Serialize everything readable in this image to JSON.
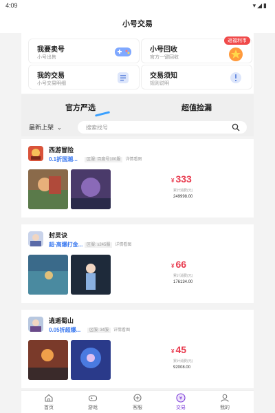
{
  "statusbar": {
    "time": "4:09",
    "icons": "▾◢▮"
  },
  "header": {
    "title": "小号交易"
  },
  "hero_cards": [
    {
      "title": "我要卖号",
      "subtitle": "小号出售",
      "icon": "gamepad-icon"
    },
    {
      "title": "小号回收",
      "subtitle": "官方一键回收",
      "icon": "medal-icon",
      "badge": "返福利币"
    },
    {
      "title": "我的交易",
      "subtitle": "小号交易明细",
      "icon": "document-icon"
    },
    {
      "title": "交易须知",
      "subtitle": "规则说明",
      "icon": "info-icon"
    }
  ],
  "tabs": [
    {
      "label": "官方严选",
      "active": true
    },
    {
      "label": "超值捡漏",
      "active": false
    }
  ],
  "filter": {
    "sort_label": "最新上架",
    "search_placeholder": "搜索找号"
  },
  "listings": [
    {
      "name": "西游冒险",
      "tagline": "0.1折国潮...",
      "server": "区服: 百度号100服",
      "detail": "详情看图",
      "price": "333",
      "currency": "¥",
      "paid_label": "累计消费(元)",
      "paid_value": "249998.00"
    },
    {
      "name": "封灵诀",
      "tagline": "超·高爆打金...",
      "server": "区服: s245服",
      "detail": "详情看图",
      "price": "66",
      "currency": "¥",
      "paid_label": "累计消费(元)",
      "paid_value": "176134.00"
    },
    {
      "name": "逍遥蜀山",
      "tagline": "0.05折超爆...",
      "server": "区服: 34服",
      "detail": "详情看图",
      "price": "45",
      "currency": "¥",
      "paid_label": "累计消费(元)",
      "paid_value": "92008.00"
    }
  ],
  "nav": [
    {
      "label": "首页",
      "icon": "home-icon",
      "active": false
    },
    {
      "label": "游戏",
      "icon": "controller-icon",
      "active": false
    },
    {
      "label": "客服",
      "icon": "headset-icon",
      "active": false
    },
    {
      "label": "交易",
      "icon": "trade-icon",
      "active": true
    },
    {
      "label": "我的",
      "icon": "profile-icon",
      "active": false
    }
  ],
  "colors": {
    "accent": "#3c7af0",
    "price": "#e8394d",
    "badge": "#f04a4a",
    "nav_active": "#7a3ad8",
    "tab_underline": "#3aa0ff"
  }
}
